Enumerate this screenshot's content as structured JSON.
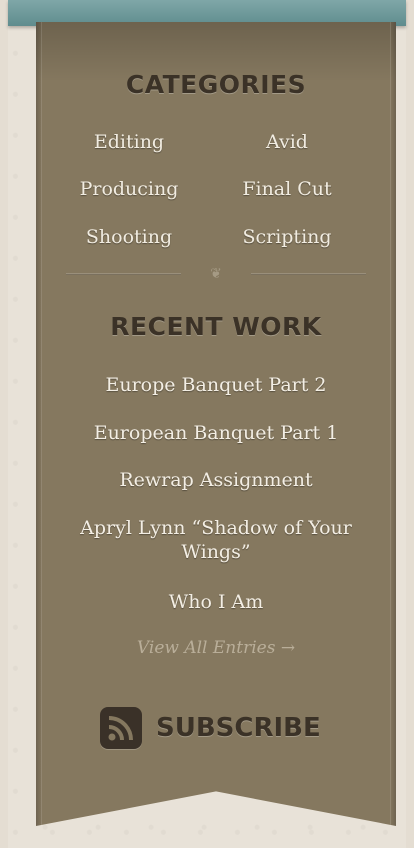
{
  "categories": {
    "title": "CATEGORIES",
    "items": [
      "Editing",
      "Avid",
      "Producing",
      "Final Cut",
      "Shooting",
      "Scripting"
    ]
  },
  "recent_work": {
    "title": "RECENT WORK",
    "items": [
      "Europe Banquet Part 2",
      "European Banquet Part 1",
      "Rewrap Assignment",
      "Apryl Lynn “Shadow of Your Wings”",
      "Who I Am"
    ],
    "view_all": "View All Entries →"
  },
  "subscribe": {
    "label": "SUBSCRIBE",
    "icon": "rss-icon"
  },
  "colors": {
    "top_bar": "#6f9b9c",
    "banner": "#85785f",
    "title_text": "#3b3227",
    "link_text": "#f1ece1"
  }
}
